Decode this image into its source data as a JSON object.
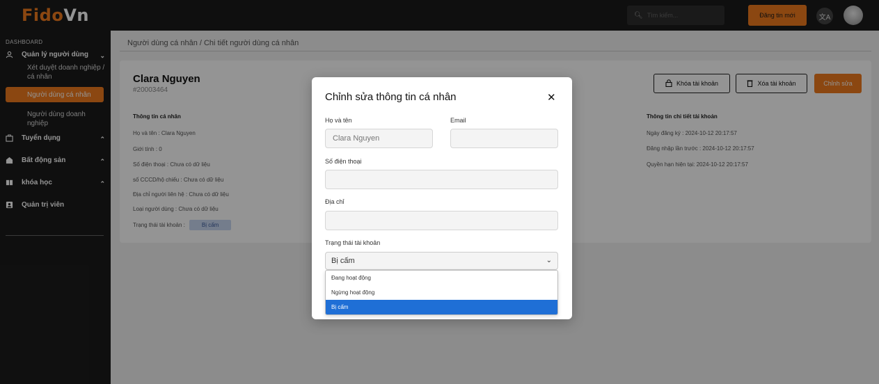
{
  "brand": {
    "name_part1": "Fido",
    "name_part2": "Vn"
  },
  "sidebar": {
    "section_label": "DASHBOARD",
    "groups": [
      {
        "label": "Quản lý người dùng",
        "icon": "user-icon"
      },
      {
        "label": "Tuyển dụng",
        "icon": "briefcase-icon"
      },
      {
        "label": "Bất động sản",
        "icon": "house-icon"
      },
      {
        "label": "khóa học",
        "icon": "book-icon"
      },
      {
        "label": "Quản trị viên",
        "icon": "admin-icon"
      }
    ],
    "subitems": [
      {
        "label": "Xét duyệt doanh nghiệp / cá nhân"
      },
      {
        "label": "Người dùng cá nhân",
        "active": true
      },
      {
        "label": "Người dùng doanh nghiệp"
      }
    ]
  },
  "topbar": {
    "search_placeholder": "Tìm kiếm...",
    "post_button": "Đăng tin mới",
    "lang_icon": "translate-icon"
  },
  "breadcrumb": "Người dùng cá nhân / Chi tiết người dùng cá nhân",
  "profile": {
    "name": "Clara Nguyen",
    "id": "#20003464",
    "personal_title": "Thông tin cá nhân",
    "personal_lines": [
      "Họ và tên : Clara Nguyen",
      "Giới tính : 0",
      "Số điện thoại : Chưa có dữ liệu",
      "số CCCD/hộ chiếu : Chưa có dữ liệu",
      "Địa chỉ người liên hệ : Chưa có dữ liệu",
      "Loại người dùng : Chưa có dữ liệu"
    ],
    "status_label": "Trạng thái tài khoản :",
    "status_value": "Bị cấm",
    "account_title": "Thông tin chi tiết tài khoản",
    "account_lines": [
      "Ngày đăng ký : 2024-10-12 20:17:57",
      "Đăng nhập lần trước : 2024-10-12 20:17:57",
      "Quyền hạn hiện tại: 2024-10-12 20:17:57"
    ],
    "buttons": {
      "lock": "Khóa tài khoản",
      "delete": "Xóa tài khoản",
      "edit": "Chỉnh sửa"
    }
  },
  "modal": {
    "title": "Chỉnh sửa thông tin cá nhân",
    "close": "✕",
    "fields": {
      "name_label": "Họ và tên",
      "name_value": "Clara Nguyen",
      "email_label": "Email",
      "email_value": "",
      "phone_label": "Số điện thoại",
      "phone_value": "",
      "address_label": "Địa chỉ",
      "address_value": "",
      "status_label": "Trạng thái tài khoản",
      "status_value": "Bị cấm"
    },
    "options": [
      "Đang hoạt động",
      "Ngừng hoạt động",
      "Bị cấm"
    ]
  },
  "colors": {
    "accent": "#f07b1e",
    "sidebar_bg": "#1b1b1b",
    "selected_option": "#1f6fd6"
  }
}
